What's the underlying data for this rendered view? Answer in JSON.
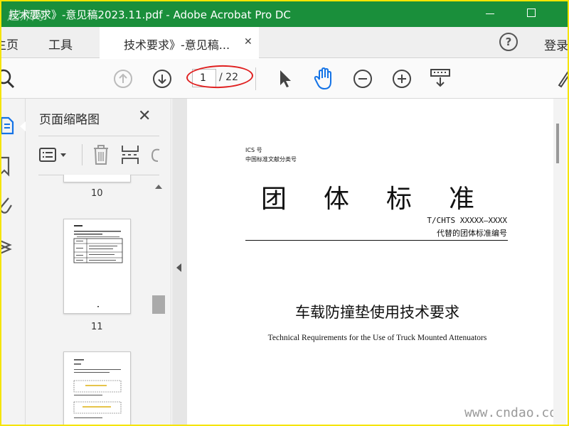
{
  "titlebar": {
    "title": "技术要求》-意见稿2023.11.pdf - Adobe Acrobat Pro DC",
    "watermark": "起师网"
  },
  "tabbar": {
    "home": "主页",
    "tools": "工具",
    "doc_tab": "技术要求》-意见稿...",
    "close": "✕",
    "help": "?",
    "login": "登录"
  },
  "toolbar": {
    "current_page": "1",
    "total_pages": "/ 22",
    "highlight_color": "#e02020"
  },
  "thumbnail_panel": {
    "title": "页面缩略图",
    "close": "✕",
    "pages": [
      "10",
      "11"
    ]
  },
  "document": {
    "ics": "ICS 号",
    "classification": "中国标准文献分类号",
    "big_title": "团体标准",
    "standard_no": "T/CHTS XXXXX—XXXX",
    "replaces": "代替的团体标准编号",
    "cn_title": "车载防撞垫使用技术要求",
    "en_title": "Technical Requirements for the Use of Truck Mounted Attenuators"
  },
  "site_watermark": "www.cndao.com",
  "colors": {
    "titlebar": "#1a8f3b",
    "frame": "#f5e400",
    "accent": "#1473e6"
  }
}
